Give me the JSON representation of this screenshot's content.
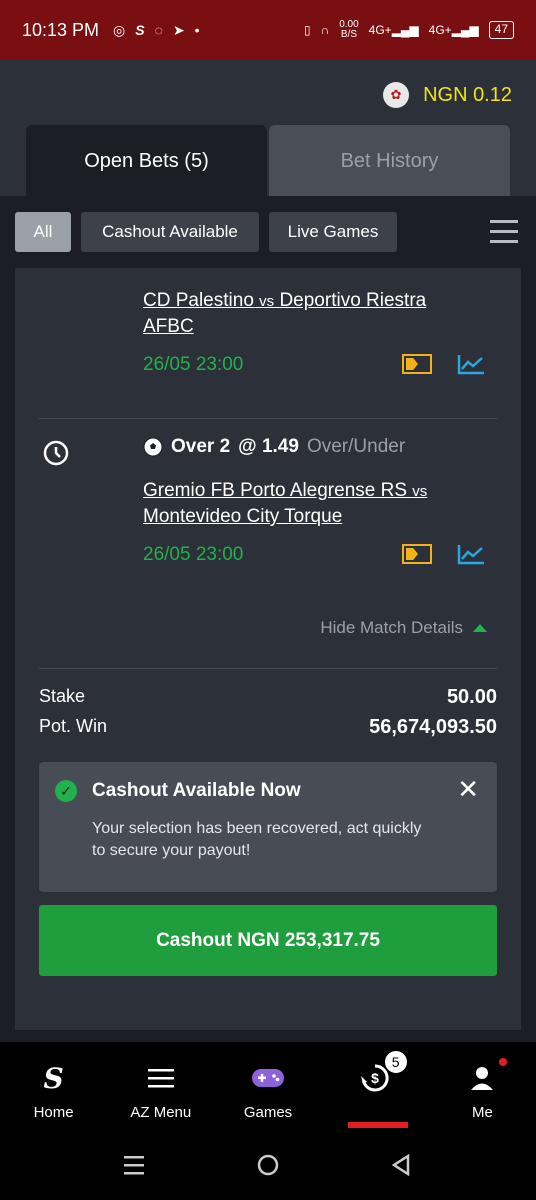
{
  "status_bar": {
    "time": "10:13 PM",
    "net_speed": "0.00",
    "net_unit": "B/S",
    "signal1": "4G+",
    "signal2": "4G+",
    "battery": "47"
  },
  "header": {
    "balance": "NGN 0.12",
    "tabs": [
      {
        "label": "Open Bets (5)",
        "active": true
      },
      {
        "label": "Bet History",
        "active": false
      }
    ]
  },
  "filters": {
    "items": [
      {
        "label": "All",
        "active": true
      },
      {
        "label": "Cashout Available",
        "active": false
      },
      {
        "label": "Live Games",
        "active": false
      }
    ]
  },
  "bet": {
    "selections": [
      {
        "home": "CD Palestino",
        "vs": "vs",
        "away": "Deportivo Riestra AFBC",
        "kickoff": "26/05 23:00"
      },
      {
        "pick": "Over 2",
        "odds": "@ 1.49",
        "market": "Over/Under",
        "home": "Gremio FB Porto Alegrense RS",
        "vs": "vs",
        "away": "Montevideo City Torque",
        "kickoff": "26/05 23:00"
      }
    ],
    "hide_details": "Hide Match Details",
    "stake_label": "Stake",
    "stake_value": "50.00",
    "potwin_label": "Pot. Win",
    "potwin_value": "56,674,093.50",
    "notice": {
      "title": "Cashout Available Now",
      "message": "Your selection has been recovered, act quickly to secure your payout!"
    },
    "cashout_button": "Cashout NGN 253,317.75"
  },
  "bottom_nav": {
    "items": [
      {
        "label": "Home",
        "icon": "sportybet-logo-icon"
      },
      {
        "label": "AZ Menu",
        "icon": "hamburger-icon"
      },
      {
        "label": "Games",
        "icon": "gamepad-icon"
      },
      {
        "label": "",
        "icon": "cashout-icon",
        "badge": "5",
        "active": true
      },
      {
        "label": "Me",
        "icon": "user-icon"
      }
    ]
  },
  "colors": {
    "status_bar": "#7a0f12",
    "accent_green": "#1f9e3e",
    "balance_yellow": "#f2e31a",
    "active_red": "#e41c23"
  }
}
